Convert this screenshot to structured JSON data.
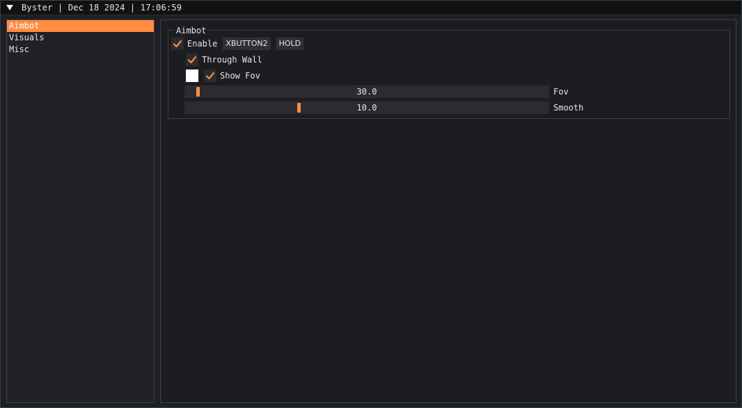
{
  "titlebar": {
    "collapse_icon": "triangle-down-icon",
    "title": "Byster | Dec 18 2024 | 17:06:59"
  },
  "sidebar": {
    "items": [
      {
        "label": "Aimbot",
        "active": true
      },
      {
        "label": "Visuals",
        "active": false
      },
      {
        "label": "Misc",
        "active": false
      }
    ]
  },
  "aimbot": {
    "group_title": "Aimbot",
    "enable": {
      "label": "Enable",
      "checked": true,
      "key": "XBUTTON2",
      "mode": "HOLD"
    },
    "through_wall": {
      "label": "Through Wall",
      "checked": true
    },
    "show_fov": {
      "label": "Show Fov",
      "checked": true,
      "color_swatch": "#ffffff"
    },
    "fov": {
      "label": "Fov",
      "value_text": "30.0",
      "value_fraction": 0.03
    },
    "smooth": {
      "label": "Smooth",
      "value_text": "10.0",
      "value_fraction": 0.31
    }
  },
  "colors": {
    "accent": "#ff8c42",
    "background": "#1b1d20",
    "frame": "#2a2c30"
  }
}
